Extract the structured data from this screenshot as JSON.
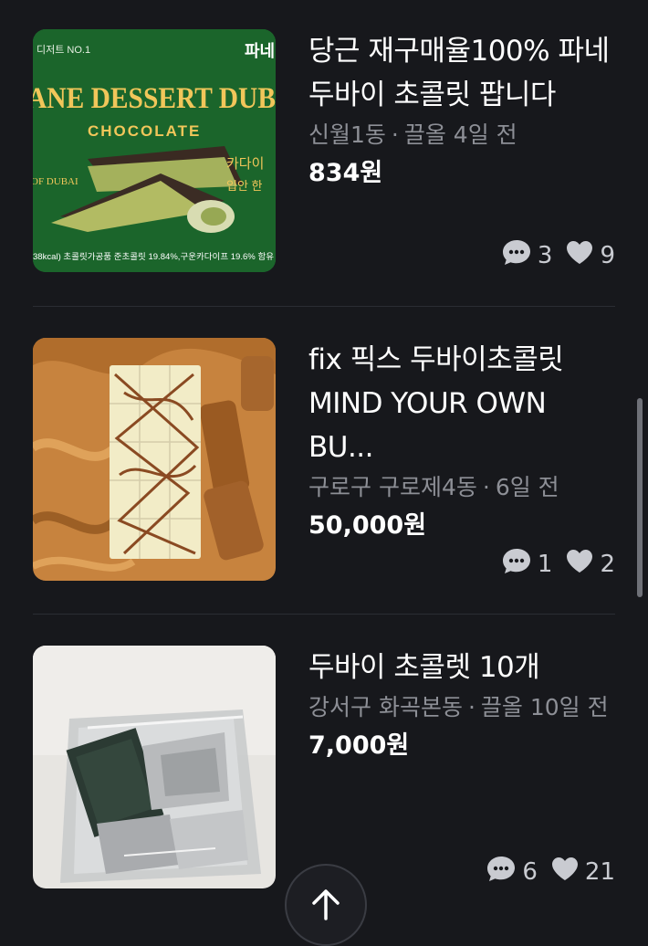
{
  "listings": [
    {
      "title": "당근 재구매율100% 파네 두바이 초콜릿 팝니다",
      "location": "신월1동",
      "bumped": "끌올 4일 전",
      "price": "834원",
      "chats": "3",
      "likes": "9",
      "thumb": {
        "top_label": "디저트 NO.1",
        "brand": "파네",
        "headline": "ANE DESSERT DUB",
        "subhead": "CHOCOLATE",
        "side_a": "카다이",
        "side_b": "입안 한",
        "origin": "OF DUBAI",
        "footer": "38kcal) 초콜릿가공품  준초콜릿 19.84%,구운카다이프 19.6% 함유"
      }
    },
    {
      "title": "fix 픽스 두바이초콜릿 MIND YOUR OWN BU...",
      "location": "구로구 구로제4동",
      "bumped": "6일 전",
      "price": "50,000원",
      "chats": "1",
      "likes": "2"
    },
    {
      "title": "두바이 초콜렛 10개",
      "location": "강서구 화곡본동",
      "bumped": "끌올 10일 전",
      "price": "7,000원",
      "chats": "6",
      "likes": "21"
    }
  ],
  "colors": {
    "background": "#17181c",
    "meta_text": "#8d8f96",
    "divider": "#2b2d33"
  },
  "icons": {
    "chat": "chat-bubble-icon",
    "like": "heart-icon",
    "scroll_top": "arrow-up-icon"
  }
}
